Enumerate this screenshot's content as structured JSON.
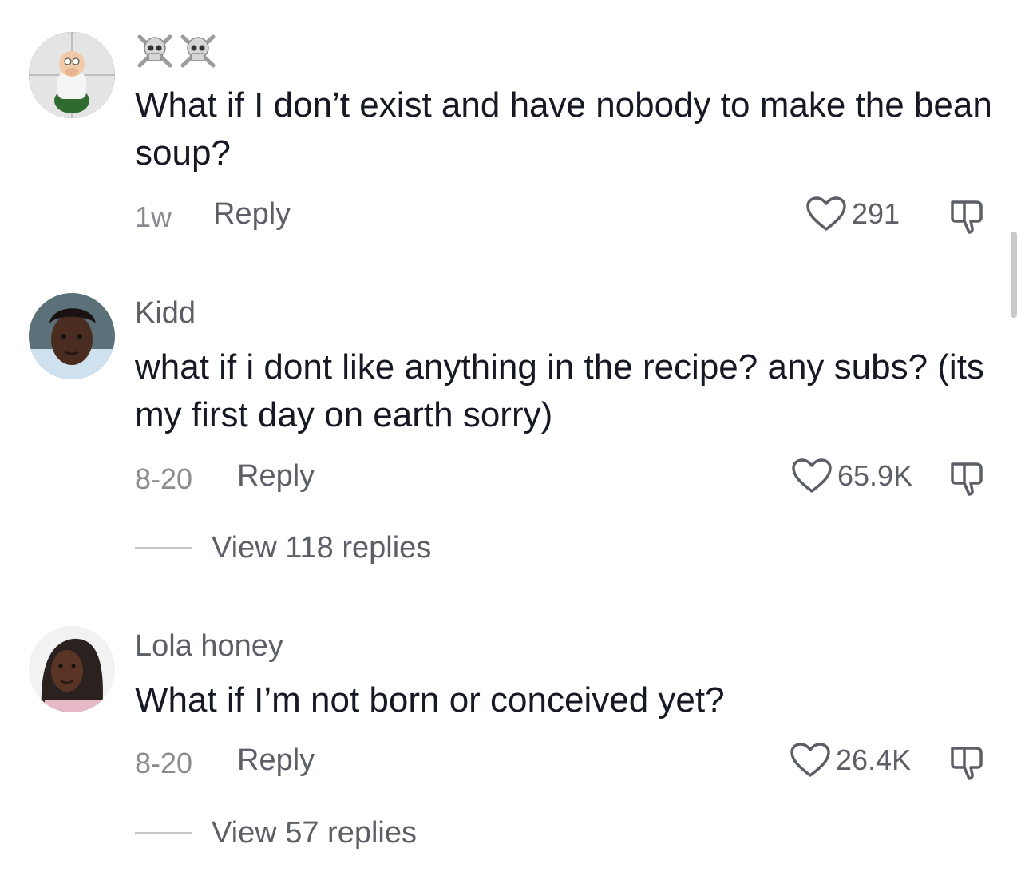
{
  "comments": [
    {
      "username": "",
      "username_emoji": [
        "skull-crossbones",
        "skull-crossbones"
      ],
      "text": "What if I don’t exist and have nobody to make the bean soup?",
      "date": "1w",
      "reply_label": "Reply",
      "likes": "291",
      "view_replies": ""
    },
    {
      "username": "Kidd",
      "text": "what if i dont like anything in the recipe? any subs? (its my first day on earth sorry)",
      "date": "8-20",
      "reply_label": "Reply",
      "likes": "65.9K",
      "view_replies": "View 118 replies"
    },
    {
      "username": "Lola honey",
      "text": "What if I’m not born or conceived yet?",
      "date": "8-20",
      "reply_label": "Reply",
      "likes": "26.4K",
      "view_replies": "View 57 replies"
    }
  ],
  "icons": {
    "like": "heart-outline-icon",
    "dislike": "thumbs-down-icon",
    "emoji": "skull-crossbones-icon"
  },
  "colors": {
    "text_primary": "#161823",
    "text_secondary": "#5d5f66",
    "text_tertiary": "#8a8b91"
  }
}
